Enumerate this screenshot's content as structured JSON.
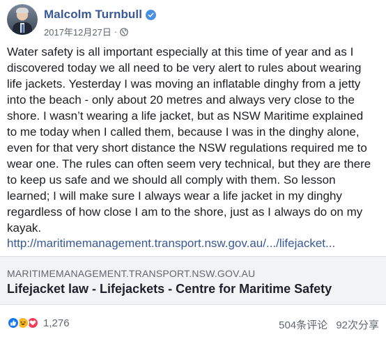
{
  "author": {
    "name": "Malcolm Turnbull",
    "verified": true
  },
  "post": {
    "timestamp": "2017年12月27日",
    "separator": "·",
    "audience_icon": "globe-icon",
    "body_lines": [
      "Water safety is all important especially at this time of year and as I",
      "discovered today we all need to be very alert to rules about wearing",
      "life jackets. Yesterday I was moving an inflatable dinghy from a jetty",
      "into the beach - only about 20 metres and always very close to the",
      "shore. I wasn’t wearing a life jacket, but as NSW Maritime explained",
      "to me today when I called them, because I was in the dinghy alone,",
      "even for that very short distance the NSW regulations required me to",
      "wear one. The rules can often seem very technical, but they are there",
      "to keep us safe and we should all comply with them. So lesson",
      "learned; I will make sure I always wear a life jacket in my dinghy",
      "regardless of how close I am to the shore, just as I always do on my",
      "kayak."
    ],
    "link_text": "http://maritimemanagement.transport.nsw.gov.au/.../lifejacket..."
  },
  "preview": {
    "domain": "MARITIMEMANAGEMENT.TRANSPORT.NSW.GOV.AU",
    "title": "Lifejacket law - Lifejackets - Centre for Maritime Safety"
  },
  "engagement": {
    "reactions": [
      "like-icon",
      "haha-icon",
      "love-icon"
    ],
    "reaction_count": "1,276",
    "comments": "504条评论",
    "shares": "92次分享"
  },
  "colors": {
    "name_link": "#385898",
    "verified_badge": "#4a90e2",
    "like": "#1877f2",
    "haha": "#f7b928",
    "love": "#f33e58",
    "preview_bg": "#f2f3f5"
  }
}
